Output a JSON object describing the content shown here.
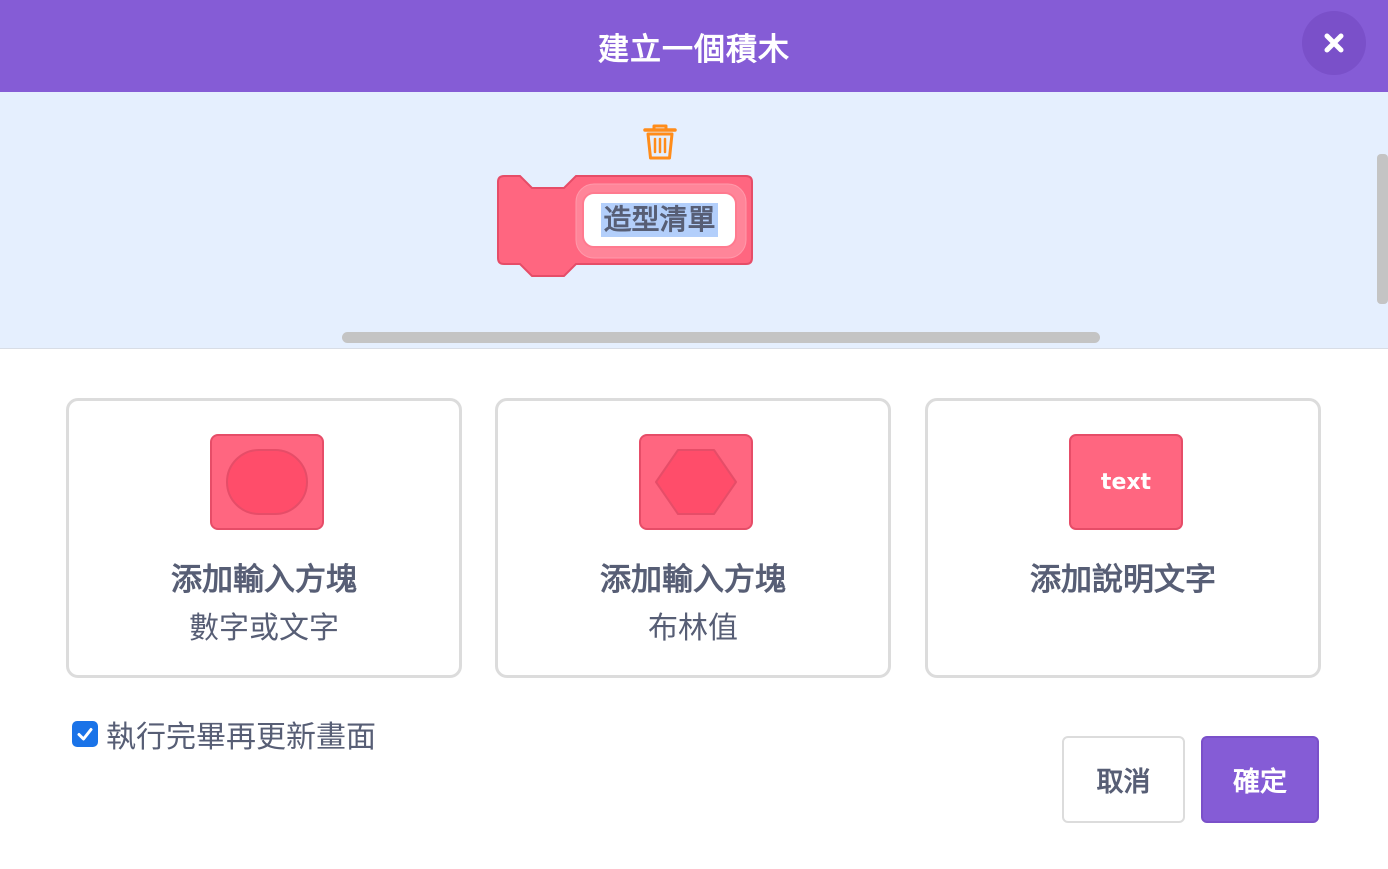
{
  "header": {
    "title": "建立一個積木",
    "close_icon": "close-icon"
  },
  "preview": {
    "block_name": "造型清單",
    "block_color": "#ff6680",
    "delete_icon": "trash-icon"
  },
  "options": [
    {
      "title": "添加輸入方塊",
      "subtitle": "數字或文字",
      "icon": "rounded-input-icon"
    },
    {
      "title": "添加輸入方塊",
      "subtitle": "布林值",
      "icon": "boolean-input-icon"
    },
    {
      "title": "添加說明文字",
      "icon_text": "text",
      "icon": "label-text-icon"
    }
  ],
  "run_without_refresh": {
    "label": "執行完畢再更新畫面",
    "checked": true
  },
  "buttons": {
    "cancel": "取消",
    "ok": "確定"
  },
  "colors": {
    "header": "#855cd6",
    "accent": "#855cd6",
    "block_pink": "#ff6680",
    "workspace": "#e5effe",
    "trash_orange": "#ff8c1a"
  }
}
